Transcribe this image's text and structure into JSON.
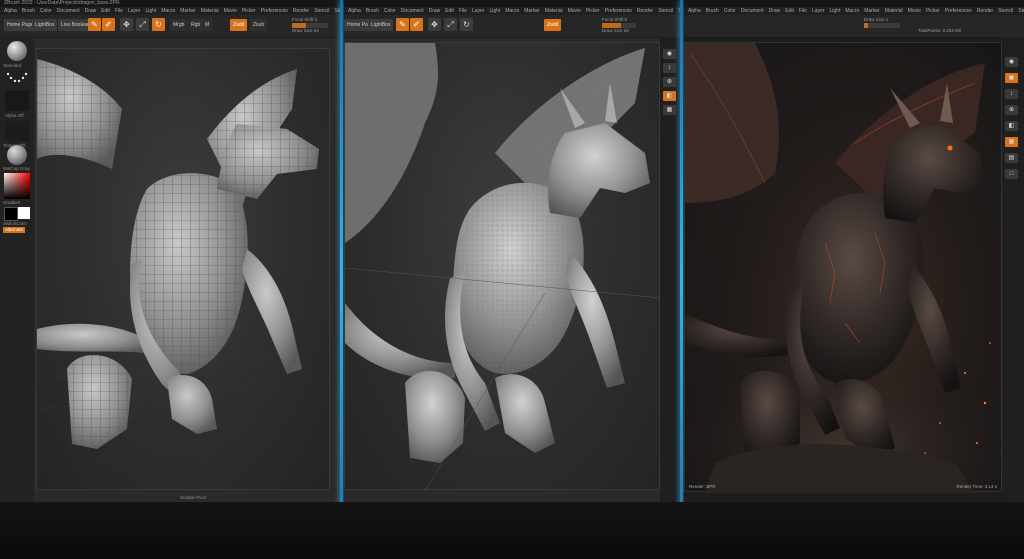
{
  "panel_base": {
    "title": "ZBrush 2022 - UserData\\Projects\\dragon_base.ZPR",
    "menu": [
      "Alpha",
      "Brush",
      "Color",
      "Document",
      "Draw",
      "Edit",
      "File",
      "Layer",
      "Light",
      "Macro",
      "Marker",
      "Material",
      "Movie",
      "Picker",
      "Preferences",
      "Render",
      "Stencil",
      "Stroke",
      "Texture",
      "Tool",
      "Transform",
      "Zplugin",
      "Zscript"
    ],
    "toolbar": {
      "home_page": "Home Page",
      "lightbox": "LightBox",
      "live_boolean": "Live Boolean",
      "edit": "Edit",
      "draw": "Draw",
      "move": "Move",
      "scale": "Scale",
      "rotate": "Rotate",
      "mrgb": "Mrgb",
      "rgb": "Rgb",
      "m": "M",
      "zadd": "Zadd",
      "zsub": "Zsub",
      "focal_shift": "Focal Shift 0",
      "draw_size": "Draw Size 64",
      "rgb_intensity": "Rgb Intensity 100",
      "z_intensity": "Z Intensity 25"
    },
    "tray": {
      "brush_label": "Standard",
      "alpha_label": "Alpha Off",
      "texture_label": "Texture Off",
      "material_label": "MatCap Gray",
      "gradient_label": "Gradient",
      "switch_color": "SwitchColor",
      "alternate": "Alternate"
    },
    "footer": "Disable Pixol"
  },
  "panel_detail": {
    "toolbar": {
      "home_page": "Home Page",
      "lightbox": "LightBox",
      "edit": "Edit",
      "draw": "Draw",
      "focal_shift": "Focal Shift 0",
      "draw_size": "Draw Size 28",
      "z_intensity": "Z Intensity 18"
    }
  },
  "panel_render": {
    "top_label": "Active Points: 1.812 Mil",
    "toolbar": {
      "draw_size": "Draw Size 1",
      "total_points": "TotalPoints: 8.254 Mil"
    },
    "bottom_left": "Render: BPR",
    "bottom_right": "Render Time: 2.14 s"
  },
  "colors": {
    "accent": "#d8731a",
    "divider": "#36b4ea",
    "panel_bg": "#2a2a2a"
  },
  "icons": [
    "material-sphere-icon",
    "alpha-icon",
    "color-picker-icon",
    "brush-icon",
    "draw-icon",
    "move-icon",
    "scale-icon",
    "rotate-icon"
  ]
}
